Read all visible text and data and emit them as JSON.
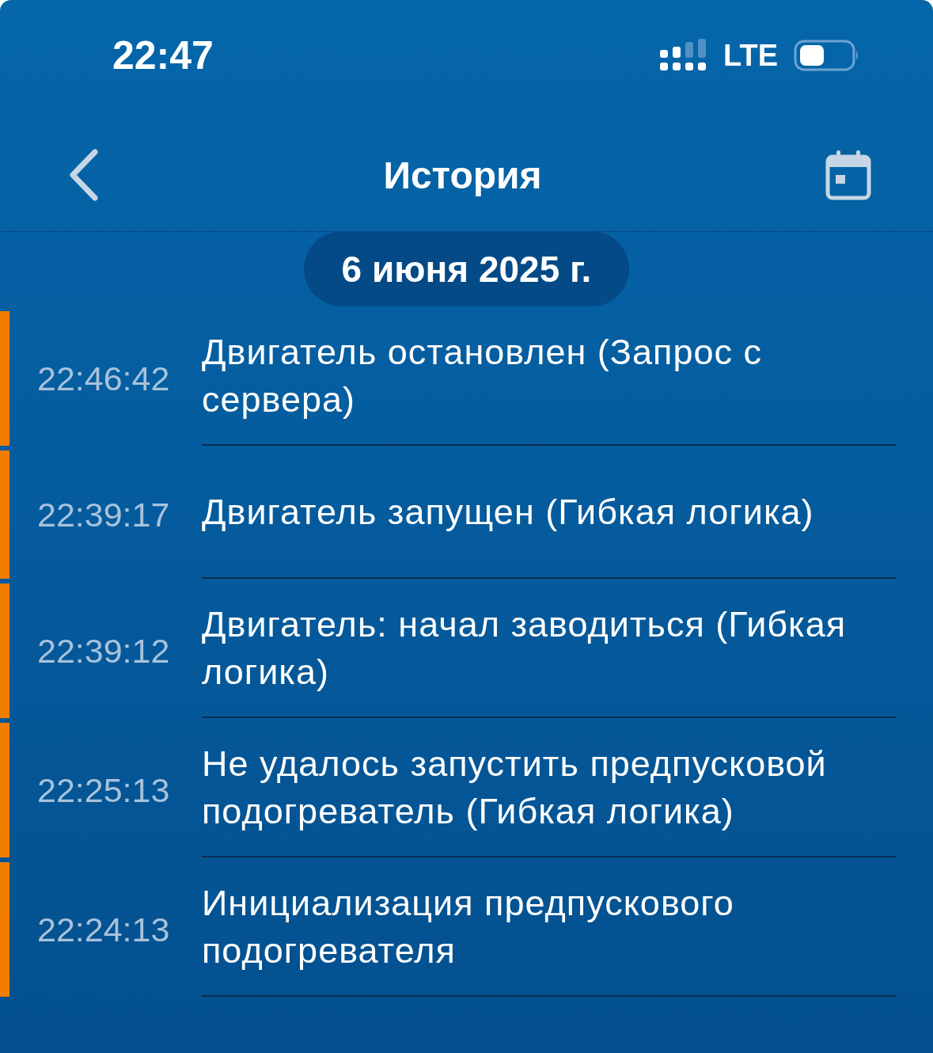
{
  "status_bar": {
    "time": "22:47",
    "network": "LTE"
  },
  "nav": {
    "title": "История"
  },
  "date": "6 июня 2025 г.",
  "events": [
    {
      "time": "22:46:42",
      "text": "Двигатель остановлен (Запрос с сервера)",
      "color": "#f07d00"
    },
    {
      "time": "22:39:17",
      "text": "Двигатель запущен (Гибкая логика)",
      "color": "#f07d00"
    },
    {
      "time": "22:39:12",
      "text": "Двигатель: начал заводиться (Гибкая логика)",
      "color": "#f07d00"
    },
    {
      "time": "22:25:13",
      "text": "Не удалось запустить предпусковой подогреватель (Гибкая логика)",
      "color": "#f07d00"
    },
    {
      "time": "22:24:13",
      "text": "Инициализация предпускового подогревателя",
      "color": "#f07d00"
    }
  ]
}
